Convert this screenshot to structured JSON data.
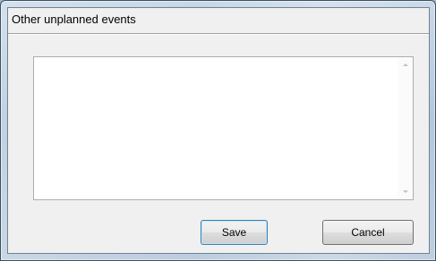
{
  "window": {
    "title": "Other unplanned events"
  },
  "editor": {
    "value": ""
  },
  "buttons": {
    "save_label": "Save",
    "cancel_label": "Cancel"
  },
  "icons": {
    "scroll_up": "scroll-up-arrow",
    "scroll_down": "scroll-down-arrow"
  }
}
